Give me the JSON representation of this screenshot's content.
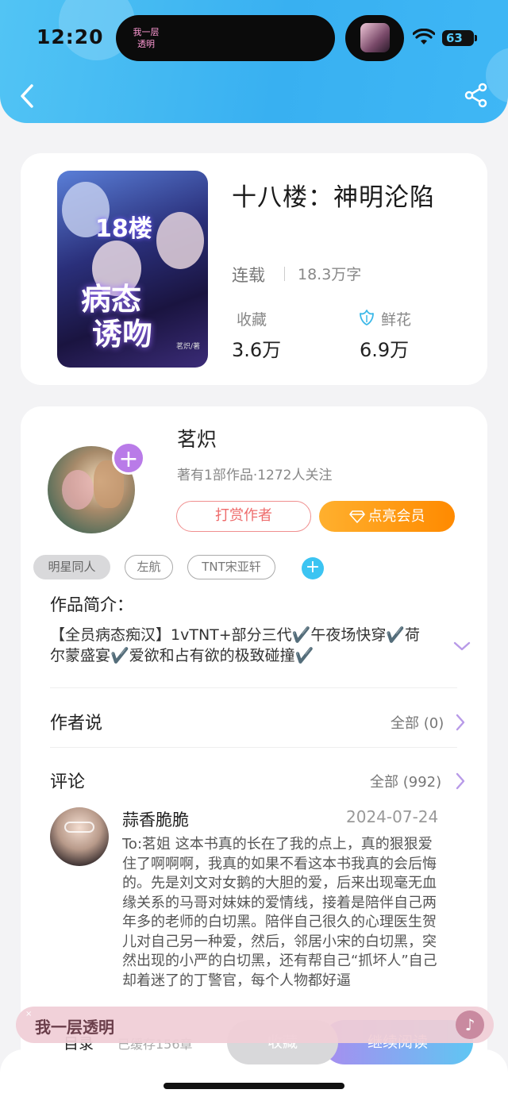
{
  "status_bar": {
    "time": "12:20",
    "island_text": "我一层 透明",
    "battery": "63"
  },
  "book": {
    "title": "十八楼：神明沦陷",
    "status": "连载",
    "words": "18.3万字",
    "collect_label": "收藏",
    "collect_value": "3.6万",
    "flower_label": "鲜花",
    "flower_value": "6.9万",
    "cover": {
      "line1": "18楼",
      "line2": "病态",
      "line3": "诱吻",
      "author_mark": "茗炽/著"
    }
  },
  "author": {
    "name": "茗炽",
    "meta": "著有1部作品·1272人关注",
    "reward_label": "打赏作者",
    "vip_label": "点亮会员",
    "tags": [
      "明星同人",
      "左航",
      "TNT宋亚轩"
    ]
  },
  "intro": {
    "title": "作品简介：",
    "text": "【全员病态痴汉】1vTNT+部分三代✔️午夜场快穿✔️荷尔蒙盛宴✔️爱欲和占有欲的极致碰撞✔️"
  },
  "author_says": {
    "title": "作者说",
    "all_label": "全部 (0)"
  },
  "comments": {
    "title": "评论",
    "all_label": "全部 (992)",
    "first": {
      "name": "蒜香脆脆",
      "date": "2024-07-24",
      "body": "To:茗姐 这本书真的长在了我的点上，真的狠狠爱住了啊啊啊，我真的如果不看这本书我真的会后悔的。先是刘文对女鹅的大胆的爱，后来出现毫无血缘关系的马哥对妹妹的爱情线，接着是陪伴自己两年多的老师的白切黑。陪伴自己很久的心理医生贺儿对自己另一种爱，然后，邻居小宋的白切黑，突然出现的小严的白切黑，还有帮自己“抓坏人”自己却着迷了的丁警官，每个人物都好逼"
    }
  },
  "bottom": {
    "catalog": "目录",
    "cached": "已缓存156章",
    "collect": "收藏",
    "read": "继续阅读"
  },
  "float_bar": {
    "text": "我一层透明"
  },
  "colors": {
    "header": "#3fb7f5",
    "vip": "#ff8a00",
    "reward": "#ee6b6b",
    "follow": "#b97be8"
  }
}
